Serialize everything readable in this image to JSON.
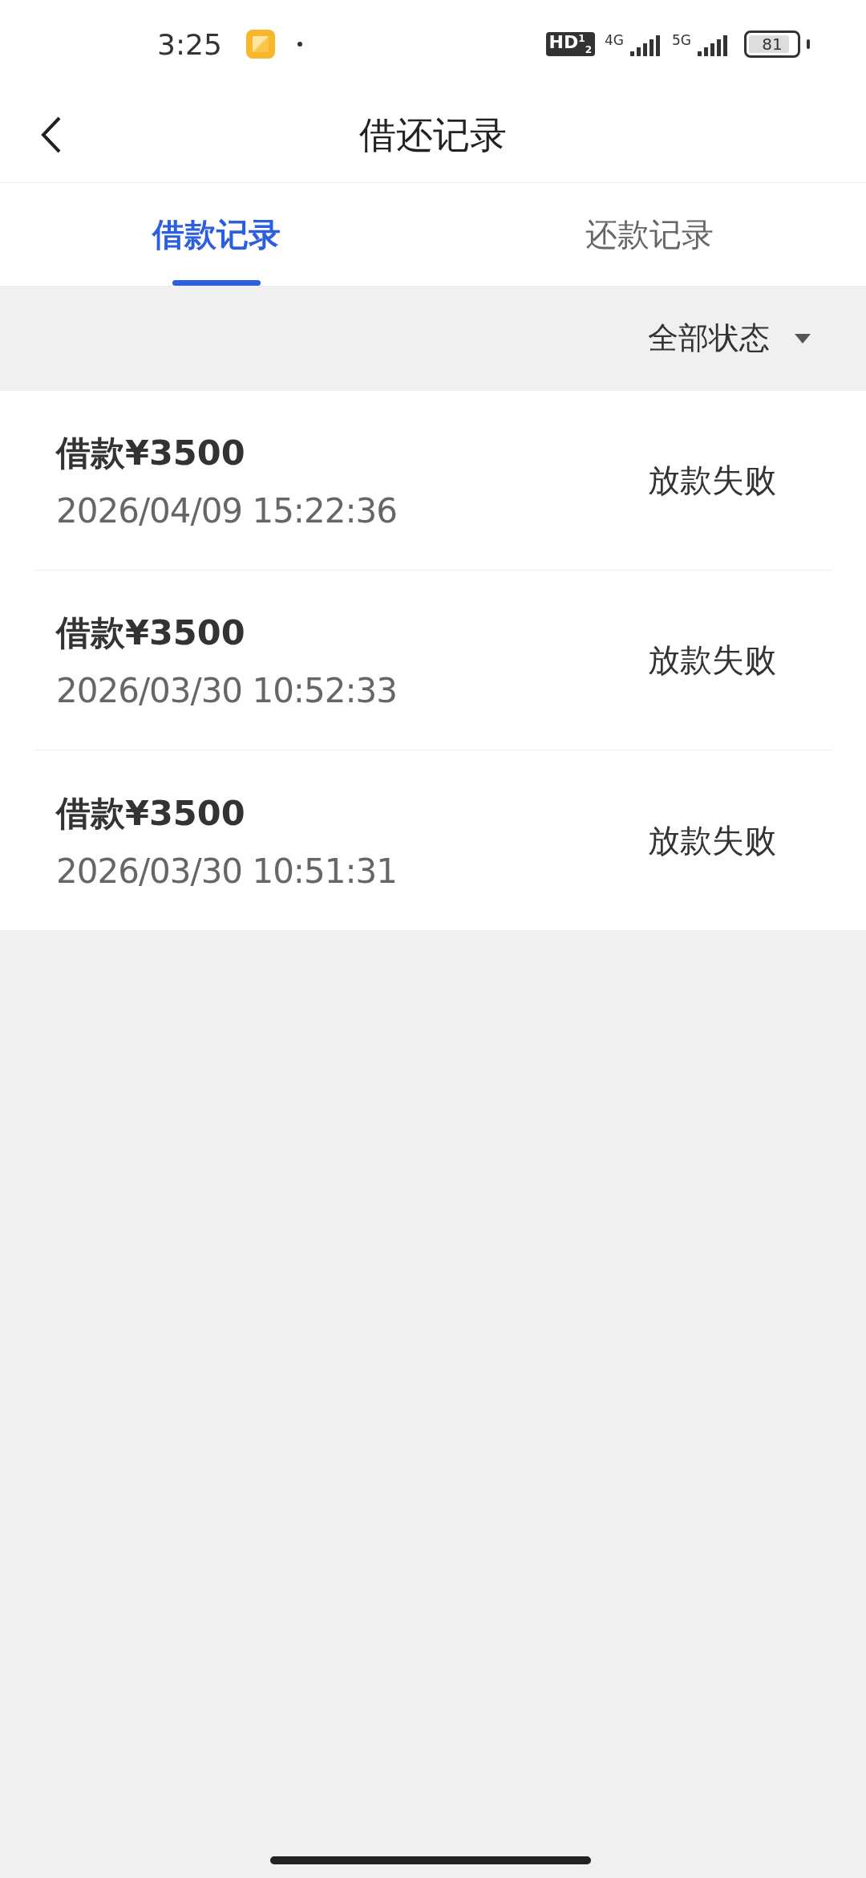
{
  "status_bar": {
    "time": "3:25",
    "hd_badge": "HD$^{1}$$_{2}$",
    "signals": [
      {
        "label": "4G"
      },
      {
        "label": "5G"
      }
    ],
    "battery": "81"
  },
  "header": {
    "title": "借还记录"
  },
  "tabs": [
    {
      "label": "借款记录",
      "selected": true
    },
    {
      "label": "还款记录",
      "selected": false
    }
  ],
  "filter": {
    "label": "全部状态"
  },
  "records": [
    {
      "amount": "借款¥3500",
      "time": "2026/04/09 15:22:36",
      "status": "放款失败"
    },
    {
      "amount": "借款¥3500",
      "time": "2026/03/30 10:52:33",
      "status": "放款失败"
    },
    {
      "amount": "借款¥3500",
      "time": "2026/03/30 10:51:31",
      "status": "放款失败"
    }
  ]
}
